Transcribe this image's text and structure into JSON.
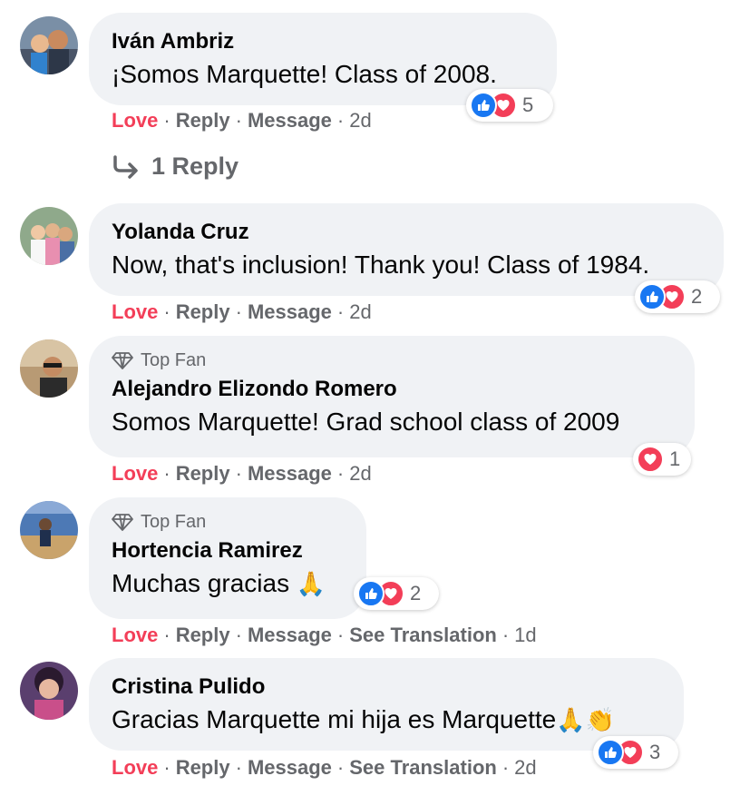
{
  "comments": [
    {
      "name": "Iván Ambriz",
      "text": "¡Somos Marquette! Class of 2008.",
      "top_fan": "",
      "reaction_count": "5",
      "reactions": [
        "like",
        "love"
      ],
      "actions": {
        "love": "Love",
        "reply": "Reply",
        "message": "Message",
        "time": "2d"
      },
      "replies_label": "1 Reply"
    },
    {
      "name": "Yolanda Cruz",
      "text": "Now, that's inclusion! Thank you! Class of 1984.",
      "reaction_count": "2",
      "reactions": [
        "like",
        "love"
      ],
      "actions": {
        "love": "Love",
        "reply": "Reply",
        "message": "Message",
        "time": "2d"
      }
    },
    {
      "name": "Alejandro Elizondo Romero",
      "top_fan": "Top Fan",
      "text": "Somos Marquette! Grad school class of 2009",
      "reaction_count": "1",
      "reactions": [
        "love"
      ],
      "actions": {
        "love": "Love",
        "reply": "Reply",
        "message": "Message",
        "time": "2d"
      }
    },
    {
      "name": "Hortencia Ramirez",
      "top_fan": "Top Fan",
      "text": "Muchas gracias",
      "emoji": "🙏",
      "reaction_count": "2",
      "reactions": [
        "like",
        "love"
      ],
      "actions": {
        "love": "Love",
        "reply": "Reply",
        "message": "Message",
        "translate": "See Translation",
        "time": "1d"
      }
    },
    {
      "name": "Cristina Pulido",
      "text": "Gracias Marquette mi hija es Marquette",
      "emoji": "🙏👏",
      "reaction_count": "3",
      "reactions": [
        "like",
        "love"
      ],
      "actions": {
        "love": "Love",
        "reply": "Reply",
        "message": "Message",
        "translate": "See Translation",
        "time": "2d"
      }
    }
  ],
  "colors": {
    "love": "#f33e58",
    "like": "#1877f2",
    "bubble": "#f0f2f5",
    "meta": "#65676b"
  },
  "icons": {
    "top_fan": "diamond-icon",
    "reply_arrow": "reply-arrow-icon",
    "like": "thumbs-up-icon",
    "love": "heart-icon"
  }
}
